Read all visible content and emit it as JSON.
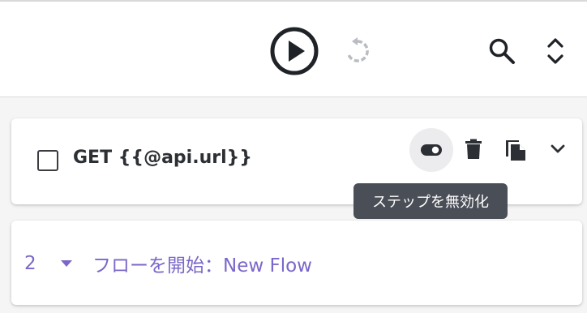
{
  "toolbar": {
    "icons": {
      "run": "play-circle-icon",
      "reset": "restart-icon",
      "search": "search-icon",
      "expand": "unfold-icon"
    }
  },
  "steps": [
    {
      "title": "GET {{@api.url}}",
      "actions": [
        "toggle-icon",
        "trash-icon",
        "copy-icon",
        "chevron-down-icon"
      ]
    }
  ],
  "tooltip": {
    "text": "ステップを無効化"
  },
  "flow_step": {
    "number": "2",
    "label": "フローを開始：New Flow"
  },
  "colors": {
    "accent": "#7b67c9",
    "text": "#2c2f33",
    "tooltip_bg": "#4a4e57",
    "muted_icon": "#b9bcc2"
  }
}
